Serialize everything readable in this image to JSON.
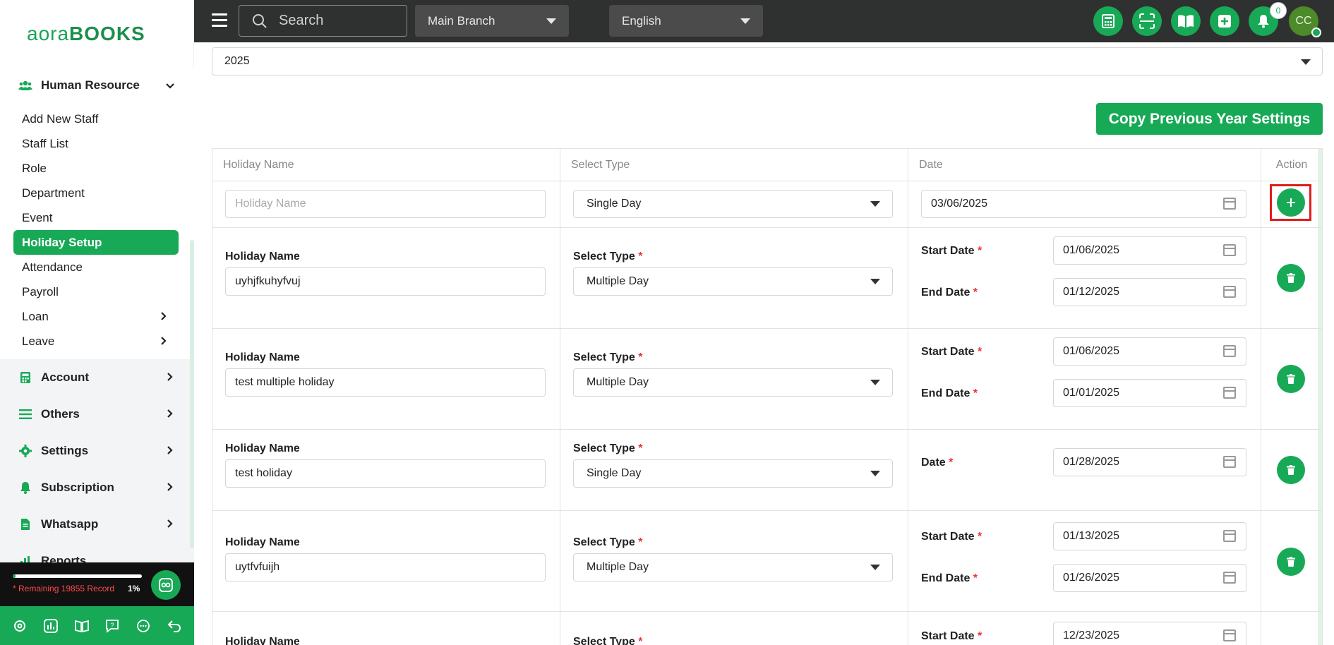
{
  "brand": {
    "logo_lo": "aora",
    "logo_hi": "BOOKS"
  },
  "topbar": {
    "search_placeholder": "Search",
    "branch": "Main Branch",
    "language": "English",
    "notification_count": "0",
    "avatar_initials": "CC"
  },
  "sidebar": {
    "section_title": "Human Resource",
    "sub_items": [
      {
        "label": "Add New Staff"
      },
      {
        "label": "Staff List"
      },
      {
        "label": "Role"
      },
      {
        "label": "Department"
      },
      {
        "label": "Event"
      },
      {
        "label": "Holiday Setup"
      },
      {
        "label": "Attendance"
      },
      {
        "label": "Payroll"
      },
      {
        "label": "Loan"
      },
      {
        "label": "Leave"
      }
    ],
    "main_items": [
      {
        "label": "Account"
      },
      {
        "label": "Others"
      },
      {
        "label": "Settings"
      },
      {
        "label": "Subscription"
      },
      {
        "label": "Whatsapp"
      },
      {
        "label": "Reports"
      }
    ],
    "remaining_text": "* Remaining 19855 Record",
    "percent_text": "1%",
    "progress_fraction": 0.01
  },
  "main": {
    "year": "2025",
    "copy_button": "Copy Previous Year Settings",
    "table_headers": {
      "name": "Holiday Name",
      "type": "Select Type",
      "date": "Date",
      "action": "Action"
    },
    "new_row": {
      "name_placeholder": "Holiday Name",
      "type": "Single Day",
      "date": "03/06/2025"
    },
    "labels": {
      "holiday_name": "Holiday Name",
      "select_type": "Select Type",
      "start_date": "Start Date",
      "end_date": "End Date",
      "date": "Date",
      "req": "*"
    },
    "rows": [
      {
        "name": "uyhjfkuhyfvuj",
        "type": "Multiple Day",
        "start": "01/06/2025",
        "end": "01/12/2025"
      },
      {
        "name": "test multiple holiday",
        "type": "Multiple Day",
        "start": "01/06/2025",
        "end": "01/01/2025"
      },
      {
        "name": "test holiday",
        "type": "Single Day",
        "date": "01/28/2025"
      },
      {
        "name": "uytfvfuijh",
        "type": "Multiple Day",
        "start": "01/13/2025",
        "end": "01/26/2025"
      },
      {
        "start": "12/23/2025"
      }
    ]
  }
}
